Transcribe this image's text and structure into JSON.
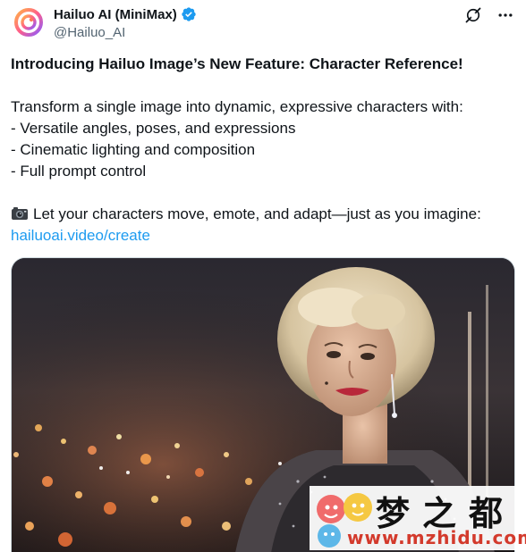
{
  "post": {
    "display_name": "Hailuo AI (MiniMax)",
    "handle": "@Hailuo_AI",
    "verified": true,
    "headline": "Introducing Hailuo Image’s New Feature: Character Reference!",
    "intro": "Transform a single image into dynamic, expressive characters with:",
    "features": [
      "- Versatile angles, poses, and expressions",
      "- Cinematic lighting and composition",
      "- Full prompt control"
    ],
    "cta": "Let your characters move, emote, and adapt—just as you imagine:",
    "link_text": "hailuoai.video/create"
  },
  "icons": {
    "avatar": "hailuo-logo-icon",
    "verified": "verified-badge-icon",
    "grok": "grok-icon",
    "more": "more-options-icon",
    "camera": "camera-emoji-icon"
  },
  "media": {
    "alt_subject": "woman-portrait-city-lights"
  },
  "watermark": {
    "chinese": "梦之都",
    "url": "www.mzhidu.com"
  },
  "colors": {
    "link": "#1d9bf0",
    "verified": "#1d9bf0",
    "text": "#0f1419",
    "secondary": "#536471",
    "watermark_url": "#d33a2c"
  }
}
